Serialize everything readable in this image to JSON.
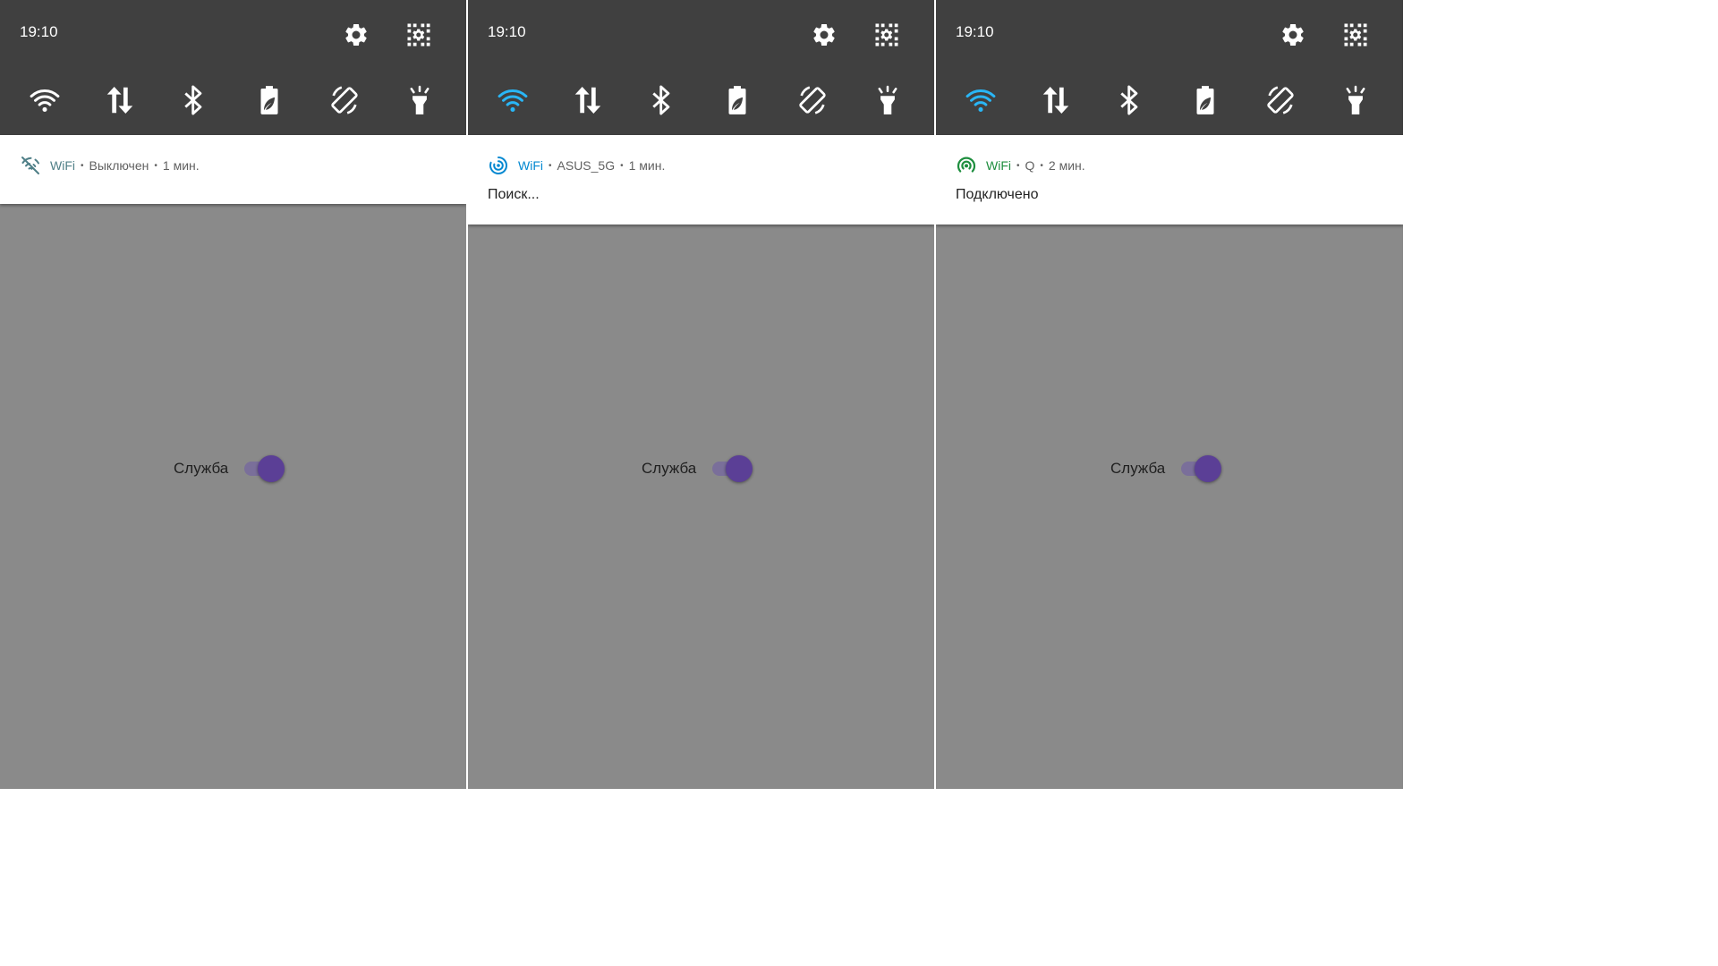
{
  "colors": {
    "qs_background": "#404040",
    "icon_default": "#ffffff",
    "wifi_active": "#29b6f6",
    "notif_off": "#4f7f87",
    "notif_searching": "#0288d1",
    "notif_connected": "#1e8e3e",
    "app_background": "#8a8a8a",
    "switch_thumb": "#5b3f96"
  },
  "panels": [
    {
      "status_bar": {
        "time": "19:10",
        "settings_icon": "gear-icon",
        "edit_icon": "edit-tiles-icon"
      },
      "quick_tiles": [
        {
          "icon": "wifi-icon",
          "active": false
        },
        {
          "icon": "data-transfer-icon",
          "active": false
        },
        {
          "icon": "bluetooth-icon",
          "active": false
        },
        {
          "icon": "battery-saver-icon",
          "active": false
        },
        {
          "icon": "auto-rotate-icon",
          "active": false
        },
        {
          "icon": "flashlight-icon",
          "active": false
        }
      ],
      "notification": {
        "icon": "wifi-off-icon",
        "app": "WiFi",
        "subtext": "Выключен",
        "time": "1 мин.",
        "body": ""
      },
      "service": {
        "label": "Служба",
        "enabled": true
      }
    },
    {
      "status_bar": {
        "time": "19:10",
        "settings_icon": "gear-icon",
        "edit_icon": "edit-tiles-icon"
      },
      "quick_tiles": [
        {
          "icon": "wifi-icon",
          "active": true
        },
        {
          "icon": "data-transfer-icon",
          "active": false
        },
        {
          "icon": "bluetooth-icon",
          "active": false
        },
        {
          "icon": "battery-saver-icon",
          "active": false
        },
        {
          "icon": "auto-rotate-icon",
          "active": false
        },
        {
          "icon": "flashlight-icon",
          "active": false
        }
      ],
      "notification": {
        "icon": "wifi-searching-icon",
        "app": "WiFi",
        "subtext": "ASUS_5G",
        "time": "1 мин.",
        "body": "Поиск..."
      },
      "service": {
        "label": "Служба",
        "enabled": true
      }
    },
    {
      "status_bar": {
        "time": "19:10",
        "settings_icon": "gear-icon",
        "edit_icon": "edit-tiles-icon"
      },
      "quick_tiles": [
        {
          "icon": "wifi-icon",
          "active": true
        },
        {
          "icon": "data-transfer-icon",
          "active": false
        },
        {
          "icon": "bluetooth-icon",
          "active": false
        },
        {
          "icon": "battery-saver-icon",
          "active": false
        },
        {
          "icon": "auto-rotate-icon",
          "active": false
        },
        {
          "icon": "flashlight-icon",
          "active": false
        }
      ],
      "notification": {
        "icon": "wifi-connected-icon",
        "app": "WiFi",
        "subtext": "Q",
        "time": "2 мин.",
        "body": "Подключено"
      },
      "service": {
        "label": "Служба",
        "enabled": true
      }
    }
  ]
}
